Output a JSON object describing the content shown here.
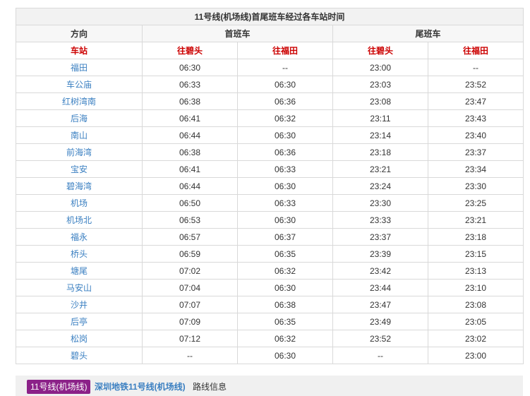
{
  "table": {
    "title": "11号线(机场线)首尾班车经过各车站时间",
    "direction_label": "方向",
    "first_train_label": "首班车",
    "last_train_label": "尾班车",
    "station_label": "车站",
    "dir_bitou": "往碧头",
    "dir_futian": "往福田",
    "rows": [
      {
        "station": "福田",
        "first_bitou": "06:30",
        "first_futian": "--",
        "last_bitou": "23:00",
        "last_futian": "--"
      },
      {
        "station": "车公庙",
        "first_bitou": "06:33",
        "first_futian": "06:30",
        "last_bitou": "23:03",
        "last_futian": "23:52"
      },
      {
        "station": "红树湾南",
        "first_bitou": "06:38",
        "first_futian": "06:36",
        "last_bitou": "23:08",
        "last_futian": "23:47"
      },
      {
        "station": "后海",
        "first_bitou": "06:41",
        "first_futian": "06:32",
        "last_bitou": "23:11",
        "last_futian": "23:43"
      },
      {
        "station": "南山",
        "first_bitou": "06:44",
        "first_futian": "06:30",
        "last_bitou": "23:14",
        "last_futian": "23:40"
      },
      {
        "station": "前海湾",
        "first_bitou": "06:38",
        "first_futian": "06:36",
        "last_bitou": "23:18",
        "last_futian": "23:37"
      },
      {
        "station": "宝安",
        "first_bitou": "06:41",
        "first_futian": "06:33",
        "last_bitou": "23:21",
        "last_futian": "23:34"
      },
      {
        "station": "碧海湾",
        "first_bitou": "06:44",
        "first_futian": "06:30",
        "last_bitou": "23:24",
        "last_futian": "23:30"
      },
      {
        "station": "机场",
        "first_bitou": "06:50",
        "first_futian": "06:33",
        "last_bitou": "23:30",
        "last_futian": "23:25"
      },
      {
        "station": "机场北",
        "first_bitou": "06:53",
        "first_futian": "06:30",
        "last_bitou": "23:33",
        "last_futian": "23:21"
      },
      {
        "station": "福永",
        "first_bitou": "06:57",
        "first_futian": "06:37",
        "last_bitou": "23:37",
        "last_futian": "23:18"
      },
      {
        "station": "桥头",
        "first_bitou": "06:59",
        "first_futian": "06:35",
        "last_bitou": "23:39",
        "last_futian": "23:15"
      },
      {
        "station": "塘尾",
        "first_bitou": "07:02",
        "first_futian": "06:32",
        "last_bitou": "23:42",
        "last_futian": "23:13"
      },
      {
        "station": "马安山",
        "first_bitou": "07:04",
        "first_futian": "06:30",
        "last_bitou": "23:44",
        "last_futian": "23:10"
      },
      {
        "station": "沙井",
        "first_bitou": "07:07",
        "first_futian": "06:38",
        "last_bitou": "23:47",
        "last_futian": "23:08"
      },
      {
        "station": "后亭",
        "first_bitou": "07:09",
        "first_futian": "06:35",
        "last_bitou": "23:49",
        "last_futian": "23:05"
      },
      {
        "station": "松岗",
        "first_bitou": "07:12",
        "first_futian": "06:32",
        "last_bitou": "23:52",
        "last_futian": "23:02"
      },
      {
        "station": "碧头",
        "first_bitou": "--",
        "first_futian": "06:30",
        "last_bitou": "--",
        "last_futian": "23:00"
      }
    ]
  },
  "footer": {
    "badge": "11号线(机场线)",
    "badge_color": "#8b2188",
    "line_link": "深圳地铁11号线(机场线)",
    "suffix": "路线信息"
  }
}
